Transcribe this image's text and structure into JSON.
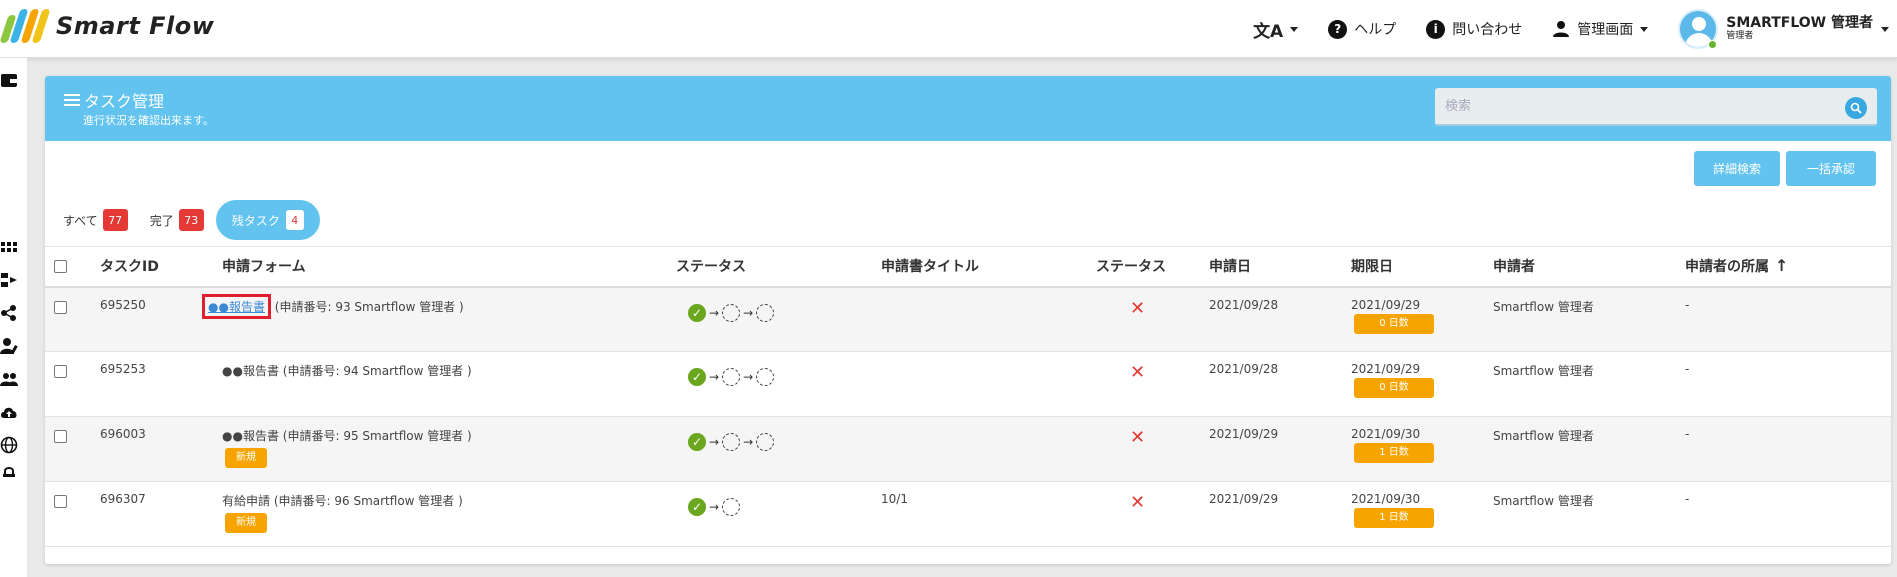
{
  "app": {
    "name": "Smart Flow"
  },
  "header": {
    "help_label": "ヘルプ",
    "contact_label": "問い合わせ",
    "admin_label": "管理画面",
    "user_name": "SMARTFLOW 管理者",
    "user_role": "管理者"
  },
  "page": {
    "title": "タスク管理",
    "subtitle": "進行状況を確認出来ます。",
    "search_placeholder": "検索",
    "detail_search_label": "詳細検索",
    "bulk_approve_label": "一括承認"
  },
  "filters": [
    {
      "label": "すべて",
      "count": "77"
    },
    {
      "label": "完了",
      "count": "73"
    },
    {
      "label": "残タスク",
      "count": "4",
      "active": true
    }
  ],
  "table": {
    "headers": [
      "タスクID",
      "申請フォーム",
      "ステータス",
      "申請書タイトル",
      "ステータス",
      "申請日",
      "期限日",
      "申請者",
      "申請者の所属"
    ],
    "rows": [
      {
        "id": "695250",
        "form_name": "●●報告書",
        "form_detail": "(申請番号: 93  Smartflow 管理者 )",
        "badge": "",
        "steps": [
          "done",
          "pending",
          "pending"
        ],
        "title": "",
        "applied": "2021/09/28",
        "deadline": "2021/09/29",
        "days": "0 日数",
        "applicant": "Smartflow 管理者",
        "dept": "-",
        "highlight": true
      },
      {
        "id": "695253",
        "form_name": "●●報告書",
        "form_detail": "(申請番号: 94  Smartflow 管理者 )",
        "badge": "",
        "steps": [
          "done",
          "pending",
          "pending"
        ],
        "title": "",
        "applied": "2021/09/28",
        "deadline": "2021/09/29",
        "days": "0 日数",
        "applicant": "Smartflow 管理者",
        "dept": "-"
      },
      {
        "id": "696003",
        "form_name": "●●報告書",
        "form_detail": "(申請番号: 95  Smartflow 管理者 )",
        "badge": "新規",
        "steps": [
          "done",
          "pending",
          "pending"
        ],
        "title": "",
        "applied": "2021/09/29",
        "deadline": "2021/09/30",
        "days": "1 日数",
        "applicant": "Smartflow 管理者",
        "dept": "-"
      },
      {
        "id": "696307",
        "form_name": "有給申請",
        "form_detail": "(申請番号: 96  Smartflow 管理者 )",
        "badge": "新規",
        "steps": [
          "done",
          "pending"
        ],
        "title": "10/1",
        "applied": "2021/09/29",
        "deadline": "2021/09/30",
        "days": "1 日数",
        "applicant": "Smartflow 管理者",
        "dept": "-"
      }
    ]
  },
  "colors": {
    "accent": "#63c3ef",
    "danger": "#e53935",
    "warning": "#f7a400",
    "success": "#6aa61e"
  }
}
